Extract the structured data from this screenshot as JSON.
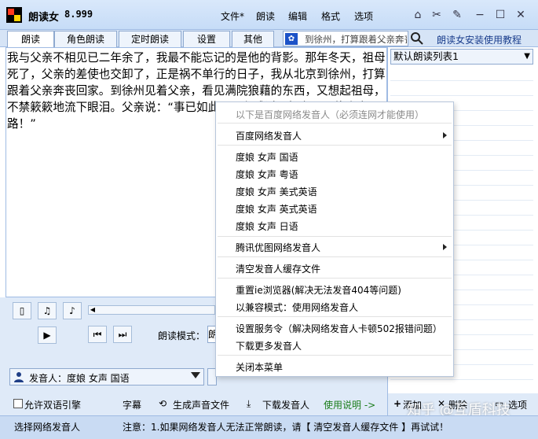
{
  "app": {
    "name": "朗读女",
    "version": "8.999"
  },
  "menu": [
    "文件*",
    "朗读",
    "编辑",
    "格式",
    "选项"
  ],
  "tabs": [
    "朗读",
    "角色朗读",
    "定时朗读",
    "设置",
    "其他"
  ],
  "search": {
    "value": "到徐州，打算跟着父亲奔丧回家",
    "tutorial_label": "朗读女安装使用教程"
  },
  "editor_text": "我与父亲不相见已二年余了，我最不能忘记的是他的背影。那年冬天，祖母死了，父亲的差使也交卸了，正是祸不单行的日子，我从北京到徐州，打算跟着父亲奔丧回家。到徐州见着父亲，看见满院狼藉的东西，又想起祖母，不禁簌簌地流下眼泪。父亲说：“事已如此，不必难过，好在天无绝人之路！”",
  "playlist": {
    "selected": "默认朗读列表1"
  },
  "controls": {
    "mode_label": "朗读模式：",
    "mode_value": "朗"
  },
  "voice": {
    "label": "发音人：度娘 女声 国语"
  },
  "bottom": {
    "bilingual": "允许双语引擎",
    "subtitle": "字幕",
    "generate": "生成声音文件",
    "download": "下载发音人",
    "help": "使用说明 ->",
    "add": "添加",
    "delete": "删除",
    "options": "选项"
  },
  "status": {
    "left": "选择网络发音人",
    "note": "注意：1.如果网络发音人无法正常朗读，请【 清空发音人缓存文件 】再试试！"
  },
  "watermark": "知乎 @互盾科技",
  "context_menu": {
    "header": "以下是百度网络发音人（必须连网才能使用）",
    "baidu": "百度网络发音人",
    "voices": [
      "度娘 女声 国语",
      "度娘 女声 粤语",
      "度娘 女声 美式英语",
      "度娘 女声 英式英语",
      "度娘 女声 日语"
    ],
    "tencent": "腾讯优图网络发音人",
    "clear_cache": "清空发音人缓存文件",
    "reset_ie": "重置ie浏览器(解决无法发音404等问题)",
    "compat_mode": "以兼容模式：使用网络发音人",
    "set_service": "设置服务令（解决网络发音人卡顿502报错问题）",
    "download_more": "下载更多发音人",
    "close": "关闭本菜单"
  }
}
